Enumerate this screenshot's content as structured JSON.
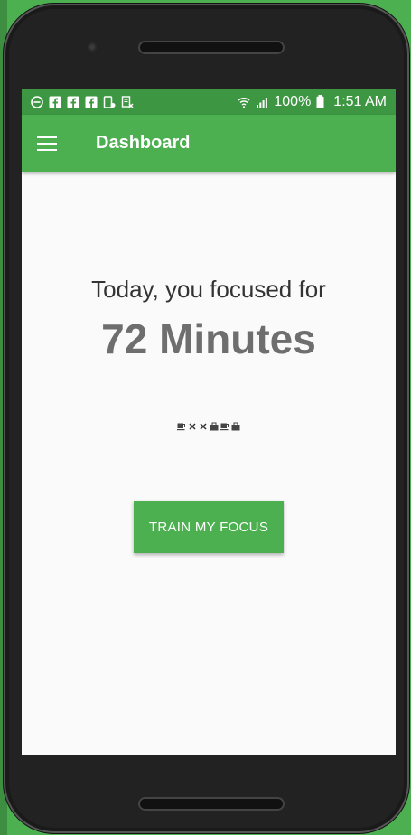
{
  "status_bar": {
    "battery": "100%",
    "time": "1:51 AM",
    "left_icons": [
      "do-not-disturb-icon",
      "facebook-icon",
      "facebook-icon",
      "facebook-icon",
      "tablet-notification-icon",
      "news-icon"
    ],
    "right_icons": [
      "wifi-icon",
      "signal-icon",
      "battery-icon"
    ]
  },
  "appbar": {
    "title": "Dashboard"
  },
  "main": {
    "headline": "Today, you focused for",
    "minutes": "72 Minutes",
    "history_icons": [
      "coffee-icon",
      "cross-icon",
      "cross-icon",
      "briefcase-icon",
      "coffee-icon",
      "briefcase-icon"
    ],
    "train_button": "TRAIN MY FOCUS"
  },
  "colors": {
    "primary": "#4caf50",
    "status_bar": "#3d9742",
    "minutes_text": "#6e6e6e"
  }
}
